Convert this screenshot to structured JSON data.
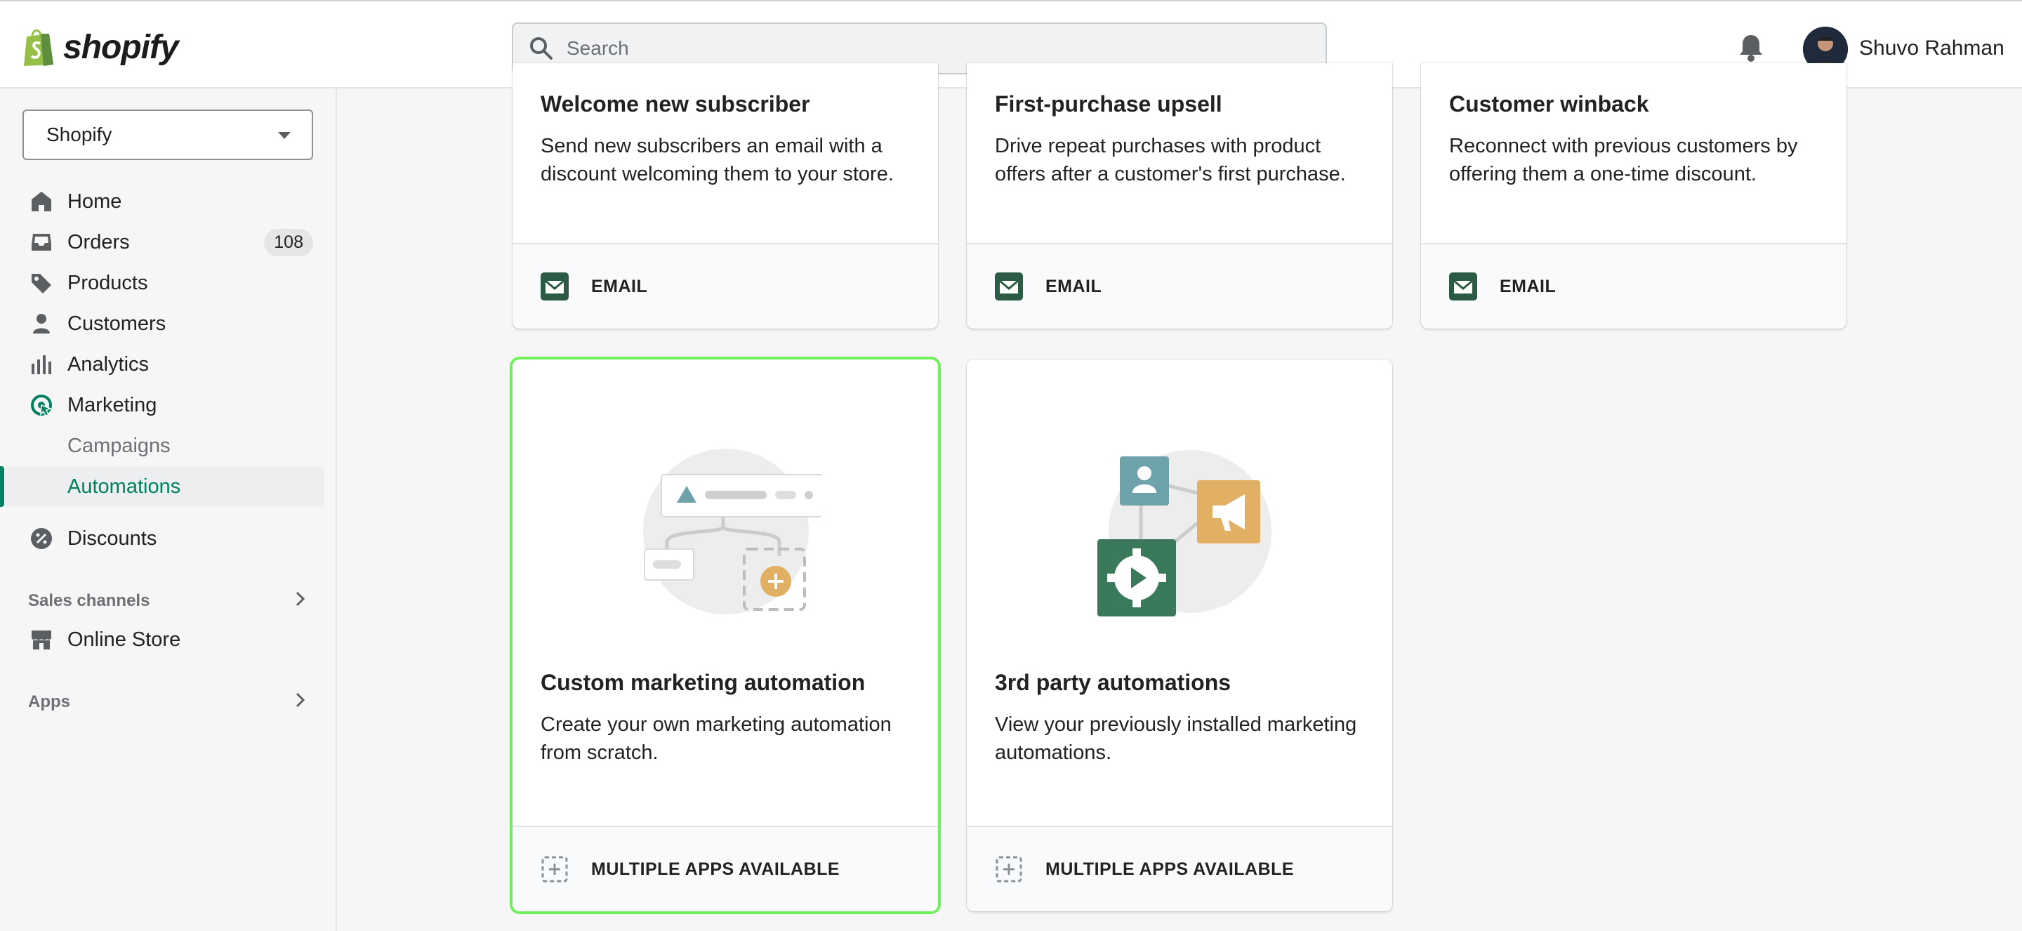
{
  "topbar": {
    "logo_text": "shopify",
    "search_placeholder": "Search",
    "user_name": "Shuvo Rahman"
  },
  "sidebar": {
    "store_name": "Shopify",
    "items": [
      {
        "label": "Home",
        "icon": "home-icon"
      },
      {
        "label": "Orders",
        "icon": "orders-icon",
        "badge": "108"
      },
      {
        "label": "Products",
        "icon": "tag-icon"
      },
      {
        "label": "Customers",
        "icon": "person-icon"
      },
      {
        "label": "Analytics",
        "icon": "bar-chart-icon"
      },
      {
        "label": "Marketing",
        "icon": "marketing-icon"
      }
    ],
    "marketing_sub": [
      "Campaigns",
      "Automations"
    ],
    "discounts": "Discounts",
    "sales_channels_label": "Sales channels",
    "online_store": "Online Store",
    "apps_label": "Apps"
  },
  "cards_top": [
    {
      "title": "Welcome new subscriber",
      "desc": "Send new subscribers an email with a discount welcoming them to your store.",
      "footer": "EMAIL"
    },
    {
      "title": "First-purchase upsell",
      "desc": "Drive repeat purchases with product offers after a customer's first purchase.",
      "footer": "EMAIL"
    },
    {
      "title": "Customer winback",
      "desc": "Reconnect with previous customers by offering them a one-time discount.",
      "footer": "EMAIL"
    }
  ],
  "cards_bottom": [
    {
      "title": "Custom marketing automation",
      "desc": "Create your own marketing automation from scratch.",
      "footer": "MULTIPLE APPS AVAILABLE"
    },
    {
      "title": "3rd party automations",
      "desc": "View your previously installed marketing automations.",
      "footer": "MULTIPLE APPS AVAILABLE"
    }
  ],
  "colors": {
    "accent": "#008060",
    "selected_outline": "#6ef05a",
    "illus_green": "#3a7a5a",
    "illus_gold": "#e2b064",
    "illus_teal": "#6ea3ac"
  }
}
